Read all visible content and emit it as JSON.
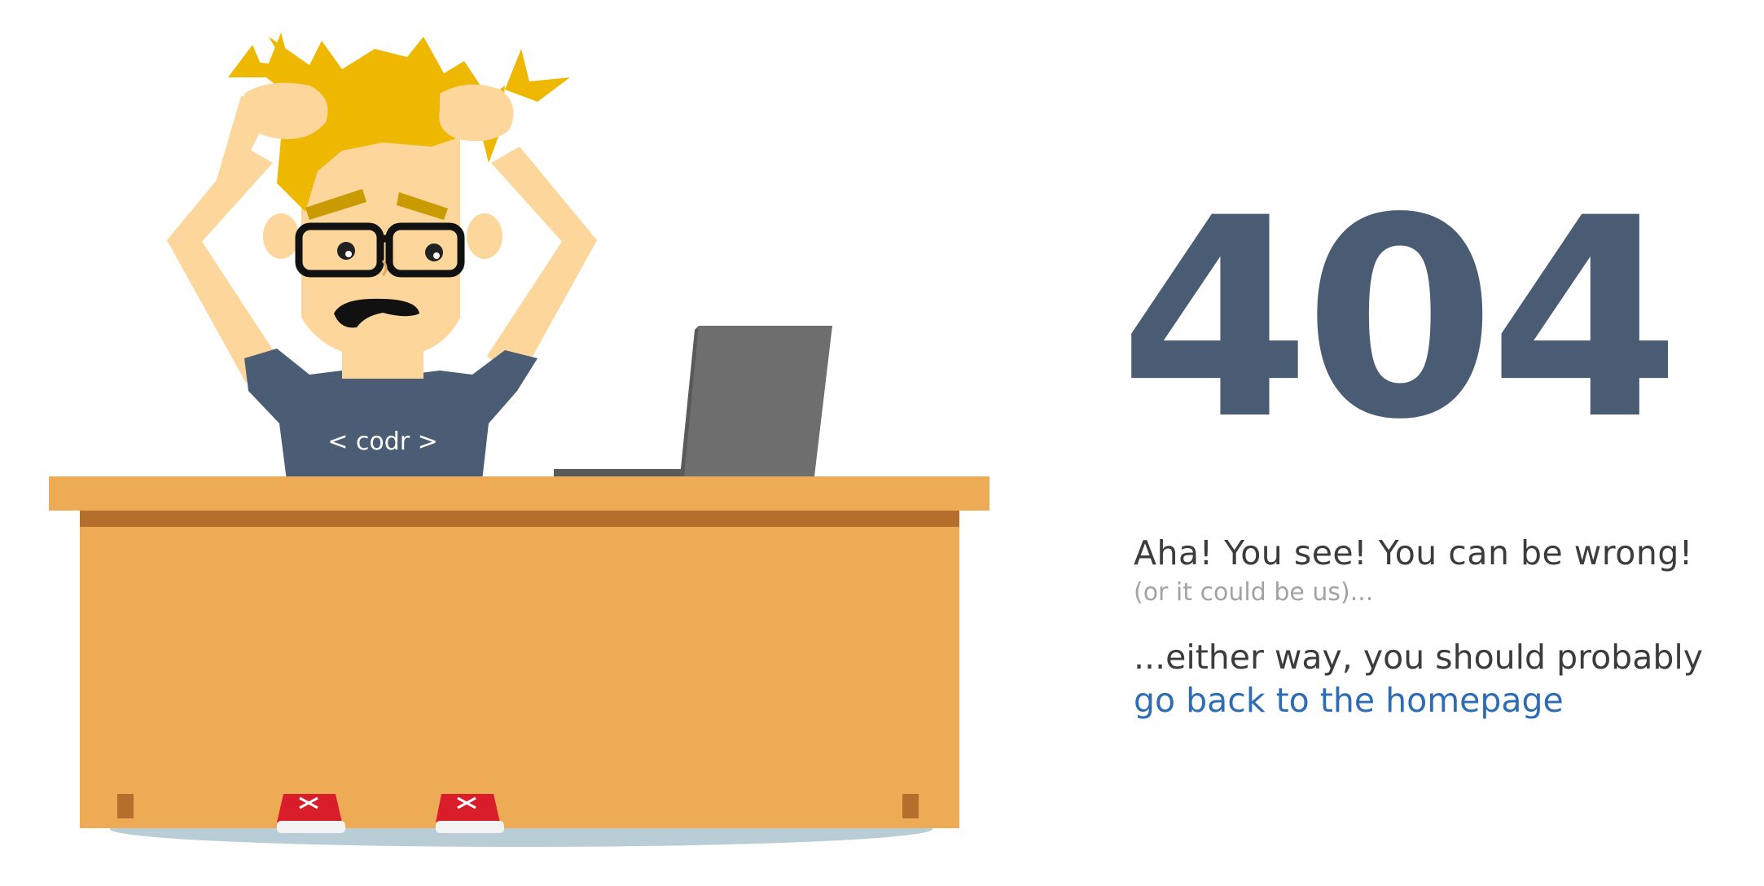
{
  "illustration": {
    "shirt_text": "< codr >"
  },
  "error": {
    "code": "404",
    "headline": "Aha! You see! You can be wrong!",
    "subline": "(or it could be us)...",
    "advice": "...either way, you should probably",
    "link_label": "go back to the homepage"
  },
  "colors": {
    "code": "#4a5c73",
    "text": "#3c3c3c",
    "muted": "#a3a3a3",
    "link": "#2e6db4",
    "desk": "#eeab56",
    "desk_shadow": "#b46f2c",
    "hair": "#efb800",
    "skin": "#fcd69a",
    "shirt": "#4b5d75",
    "laptop": "#6e6e6e"
  }
}
